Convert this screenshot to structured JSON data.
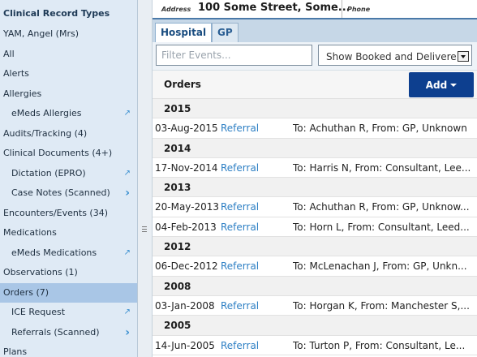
{
  "sidebar": {
    "title": "Clinical Record Types",
    "items": [
      {
        "label": "YAM, Angel (Mrs)",
        "level": 0,
        "trail": ""
      },
      {
        "label": "All",
        "level": 0,
        "trail": ""
      },
      {
        "label": "Alerts",
        "level": 0,
        "trail": ""
      },
      {
        "label": "Allergies",
        "level": 0,
        "trail": ""
      },
      {
        "label": "eMeds Allergies",
        "level": 1,
        "trail": "external"
      },
      {
        "label": "Audits/Tracking (4)",
        "level": 0,
        "trail": ""
      },
      {
        "label": "Clinical Documents (4+)",
        "level": 0,
        "trail": ""
      },
      {
        "label": "Dictation (EPRO)",
        "level": 1,
        "trail": "external"
      },
      {
        "label": "Case Notes (Scanned)",
        "level": 1,
        "trail": "chevron"
      },
      {
        "label": "Encounters/Events (34)",
        "level": 0,
        "trail": ""
      },
      {
        "label": "Medications",
        "level": 0,
        "trail": ""
      },
      {
        "label": "eMeds Medications",
        "level": 1,
        "trail": "external"
      },
      {
        "label": "Observations (1)",
        "level": 0,
        "trail": ""
      },
      {
        "label": "Orders (7)",
        "level": 0,
        "trail": "",
        "active": true
      },
      {
        "label": "ICE Request",
        "level": 1,
        "trail": "external"
      },
      {
        "label": "Referrals (Scanned)",
        "level": 1,
        "trail": "chevron"
      },
      {
        "label": "Plans",
        "level": 0,
        "trail": ""
      }
    ]
  },
  "header": {
    "address_label": "Address",
    "address_value": "100 Some Street, Some...",
    "phone_label": "Phone"
  },
  "tabs": [
    {
      "label": "Hospital",
      "active": true
    },
    {
      "label": "GP",
      "active": false
    }
  ],
  "filter": {
    "placeholder": "Filter Events...",
    "select_value": "Show Booked and Delivere"
  },
  "orders": {
    "title": "Orders",
    "add_label": "Add"
  },
  "icons": {
    "external": "external-link-icon",
    "chevron": "chevron-right-icon",
    "caret": "caret-down-icon"
  },
  "colors": {
    "sidebar_bg": "#dfeaf5",
    "active_item": "#a9c6e6",
    "link": "#2d7fc4",
    "add_button": "#0d3f8f"
  },
  "groups": [
    {
      "year": "2015",
      "rows": [
        {
          "date": "03-Aug-2015",
          "type": "Referral",
          "desc": "To: Achuthan R, From: GP, Unknown"
        }
      ]
    },
    {
      "year": "2014",
      "rows": [
        {
          "date": "17-Nov-2014",
          "type": "Referral",
          "desc": "To: Harris N, From: Consultant, Lee..."
        }
      ]
    },
    {
      "year": "2013",
      "rows": [
        {
          "date": "20-May-2013",
          "type": "Referral",
          "desc": "To: Achuthan R, From: GP, Unknow..."
        },
        {
          "date": "04-Feb-2013",
          "type": "Referral",
          "desc": "To: Horn L, From: Consultant, Leed..."
        }
      ]
    },
    {
      "year": "2012",
      "rows": [
        {
          "date": "06-Dec-2012",
          "type": "Referral",
          "desc": "To: McLenachan J, From: GP, Unkn..."
        }
      ]
    },
    {
      "year": "2008",
      "rows": [
        {
          "date": "03-Jan-2008",
          "type": "Referral",
          "desc": "To: Horgan K, From: Manchester S,..."
        }
      ]
    },
    {
      "year": "2005",
      "rows": [
        {
          "date": "14-Jun-2005",
          "type": "Referral",
          "desc": "To: Turton P, From: Consultant, Le..."
        }
      ]
    }
  ]
}
